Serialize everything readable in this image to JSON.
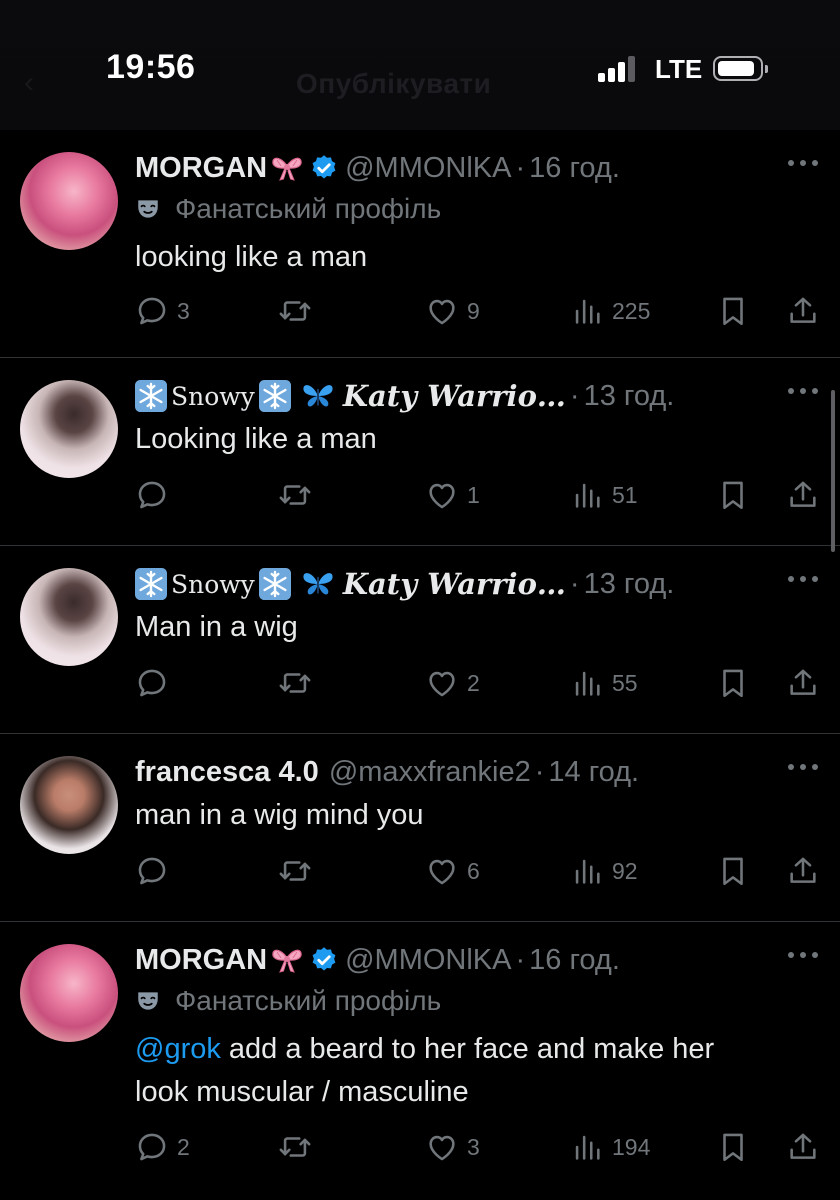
{
  "status_bar": {
    "time": "19:56",
    "network": "LTE",
    "ghost_title": "Опублікувати",
    "back_glyph": "‹"
  },
  "colors": {
    "background": "#000000",
    "text": "#e7e9ea",
    "muted": "#71767b",
    "accent": "#1d9bf0",
    "divider": "#2f3336"
  },
  "icons": {
    "reply": "reply-icon",
    "retweet": "retweet-icon",
    "like": "heart-icon",
    "views": "views-icon",
    "bookmark": "bookmark-icon",
    "share": "share-icon",
    "more": "more-dots-icon",
    "verified": "verified-badge-icon",
    "bow": "ribbon-emoji-icon",
    "mask": "theater-mask-icon",
    "snowflake": "snowflake-emoji-icon",
    "butterfly": "butterfly-emoji-icon"
  },
  "tweets": [
    {
      "name": "MORGAN",
      "handle": "@MMONlKA",
      "time": "16 год.",
      "badge": "Фанатський профіль",
      "text": "looking like a man",
      "replies": "3",
      "likes": "9",
      "views": "225"
    },
    {
      "name_part1": "Snowy",
      "name_part2": "Katy Warrio…",
      "time": "13 год.",
      "text": "Looking like a man",
      "replies": "",
      "likes": "1",
      "views": "51"
    },
    {
      "name_part1": "Snowy",
      "name_part2": "Katy Warrio…",
      "time": "13 год.",
      "text": "Man in a wig",
      "replies": "",
      "likes": "2",
      "views": "55"
    },
    {
      "name": "francesca 4.0",
      "handle": "@maxxfrankie2",
      "time": "14 год.",
      "text": "man in a wig mind you",
      "replies": "",
      "likes": "6",
      "views": "92"
    },
    {
      "name": "MORGAN",
      "handle": "@MMONlKA",
      "time": "16 год.",
      "badge": "Фанатський профіль",
      "mention": "@grok",
      "text_line1": " add a beard to her face and make her",
      "text_line2": "look muscular / masculine",
      "replies": "2",
      "likes": "3",
      "views": "194"
    }
  ]
}
